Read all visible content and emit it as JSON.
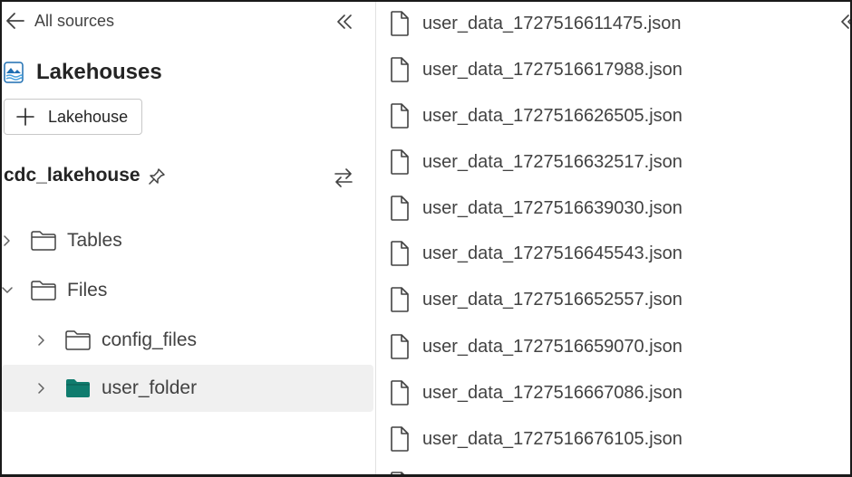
{
  "nav": {
    "back_label": "All sources"
  },
  "section": {
    "title": "Lakehouses",
    "add_button_label": "Lakehouse"
  },
  "lakehouse": {
    "name": "cdc_lakehouse"
  },
  "tree": [
    {
      "label": "Tables",
      "expanded": false,
      "selected": false,
      "level": 0
    },
    {
      "label": "Files",
      "expanded": true,
      "selected": false,
      "level": 0
    },
    {
      "label": "config_files",
      "expanded": false,
      "selected": false,
      "level": 1
    },
    {
      "label": "user_folder",
      "expanded": false,
      "selected": true,
      "level": 1
    }
  ],
  "files": [
    "user_data_1727516611475.json",
    "user_data_1727516617988.json",
    "user_data_1727516626505.json",
    "user_data_1727516632517.json",
    "user_data_1727516639030.json",
    "user_data_1727516645543.json",
    "user_data_1727516652557.json",
    "user_data_1727516659070.json",
    "user_data_1727516667086.json",
    "user_data_1727516676105.json"
  ],
  "colors": {
    "selected_folder": "#107c6e",
    "selected_row_bg": "#f0f0f0",
    "lakehouse_icon": "#1f6fb2"
  }
}
